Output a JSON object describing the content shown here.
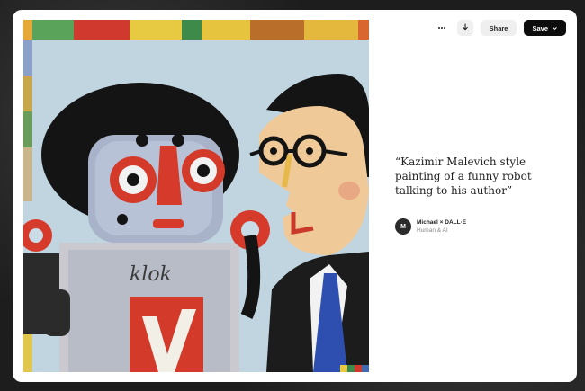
{
  "toolbar": {
    "more_icon": "more-horizontal-icon",
    "download_icon": "download-icon",
    "share_label": "Share",
    "save_label": "Save",
    "save_chevron_icon": "chevron-down-icon"
  },
  "image": {
    "painted_text": "klok"
  },
  "caption": {
    "text": "“Kazimir Malevich style painting of a funny robot talking to his author”"
  },
  "author": {
    "avatar_initial": "M",
    "name": "Michael × DALL·E",
    "subtitle": "Human & AI"
  },
  "colors": {
    "save_button_bg": "#0d0d0d",
    "secondary_button_bg": "#efefef",
    "modal_bg": "#ffffff"
  }
}
